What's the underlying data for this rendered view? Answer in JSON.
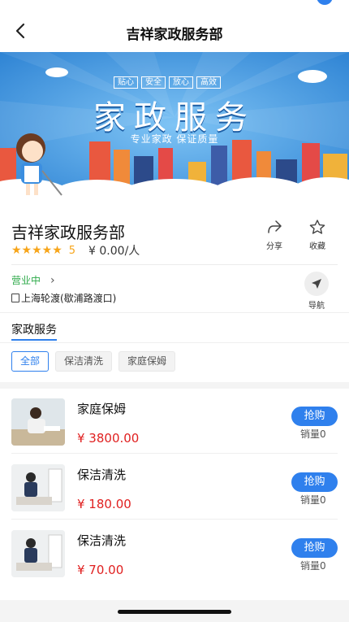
{
  "nav": {
    "title": "吉祥家政服务部"
  },
  "banner": {
    "heading": "家政服务",
    "subtitle": "专业家政 保证质量",
    "tags": [
      "贴心",
      "安全",
      "放心",
      "高效"
    ]
  },
  "shop": {
    "name": "吉祥家政服务部",
    "stars": "★★★★★",
    "rating": "5",
    "price_per": "¥ 0.00/人",
    "share_label": "分享",
    "fav_label": "收藏",
    "status": "营业中",
    "address": "上海轮渡(歇浦路渡口)",
    "nav_label": "导航"
  },
  "services": {
    "tab": "家政服务",
    "chips": [
      "全部",
      "保洁清洗",
      "家庭保姆"
    ],
    "items": [
      {
        "name": "家庭保姆",
        "price": "¥ 3800.00",
        "buy_label": "抢购",
        "sold": "销量0"
      },
      {
        "name": "保洁清洗",
        "price": "¥ 180.00",
        "buy_label": "抢购",
        "sold": "销量0"
      },
      {
        "name": "保洁清洗",
        "price": "¥ 70.00",
        "buy_label": "抢购",
        "sold": "销量0"
      }
    ]
  },
  "colors": {
    "accent": "#2f80ed",
    "price": "#e02020",
    "open": "#2eaa4a",
    "star": "#f7a51a"
  }
}
